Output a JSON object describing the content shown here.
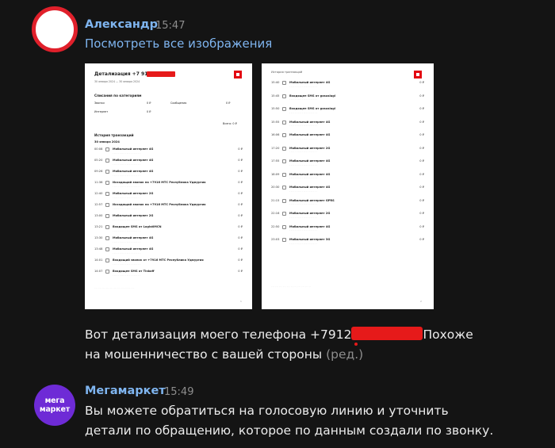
{
  "messages": [
    {
      "author": "Александр",
      "time": "15:47",
      "link_text": "Посмотреть все изображения",
      "text_part1": "Вот детализация моего телефона +7912",
      "text_part2": "Похоже",
      "text_line2": "на мошенничество с вашей стороны",
      "edited_label": "(ред.)"
    },
    {
      "author": "Мегамаркет",
      "time": "15:49",
      "avatar_line1": "мега",
      "avatar_line2": "маркет",
      "text_line1": "Вы можете обратиться на голосовую линию и уточнить",
      "text_line2": "детали по обращению, которое по данным создали по звонку."
    }
  ],
  "doc1": {
    "title": "Детализация +7 912",
    "period": "30 января 2024 — 30 января 2024",
    "section_categories": "Списания по категориям",
    "cat_calls": "Звонки",
    "cat_calls_val": "0 ₽",
    "cat_sms": "Сообщения",
    "cat_sms_val": "0 ₽",
    "cat_internet": "Интернет",
    "cat_internet_val": "0 ₽",
    "total": "Всего: 0 ₽",
    "section_history": "История транзакций",
    "date": "30 января 2024",
    "rows": [
      {
        "time": "00:08",
        "title": "Мобильный интернет 4G",
        "amount": "0 ₽"
      },
      {
        "time": "05:20",
        "title": "Мобильный интернет 4G",
        "amount": "0 ₽"
      },
      {
        "time": "09:26",
        "title": "Мобильный интернет 4G",
        "amount": "0 ₽"
      },
      {
        "time": "11:36",
        "title": "Исходящий звонок на +7916 МТС Республика Удмуртия",
        "amount": "0 ₽"
      },
      {
        "time": "12:40",
        "title": "Мобильный интернет 2G",
        "amount": "0 ₽"
      },
      {
        "time": "12:57",
        "title": "Исходящий звонок на +7916 МТС Республика Удмуртия",
        "amount": "0 ₽"
      },
      {
        "time": "13:00",
        "title": "Мобильный интернет 2G",
        "amount": "0 ₽"
      },
      {
        "time": "13:21",
        "title": "Входящее SMS от LogistiMCN",
        "amount": "0 ₽"
      },
      {
        "time": "13:30",
        "title": "Мобильный интернет 4G",
        "amount": "0 ₽"
      },
      {
        "time": "13:48",
        "title": "Мобильный интернет 4G",
        "amount": "0 ₽"
      },
      {
        "time": "14:01",
        "title": "Входящий звонок от +7916 МТС Республика Удмуртия",
        "amount": "0 ₽"
      },
      {
        "time": "14:07",
        "title": "Входящее SMS от Tinkoff",
        "amount": "0 ₽"
      }
    ]
  },
  "doc2": {
    "header": "История транзакций",
    "rows": [
      {
        "time": "15:40",
        "title": "Мобильный интернет 4G",
        "amount": "0 ₽"
      },
      {
        "time": "15:45",
        "title": "Входящее SMS от gosuslugi",
        "amount": "0 ₽"
      },
      {
        "time": "15:50",
        "title": "Входящее SMS от gosuslugi",
        "amount": "0 ₽"
      },
      {
        "time": "15:55",
        "title": "Мобильный интернет 4G",
        "amount": "0 ₽"
      },
      {
        "time": "16:06",
        "title": "Мобильный интернет 4G",
        "amount": "0 ₽"
      },
      {
        "time": "17:20",
        "title": "Мобильный интернет 2G",
        "amount": "0 ₽"
      },
      {
        "time": "17:55",
        "title": "Мобильный интернет 4G",
        "amount": "0 ₽"
      },
      {
        "time": "18:09",
        "title": "Мобильный интернет 4G",
        "amount": "0 ₽"
      },
      {
        "time": "20:30",
        "title": "Мобильный интернет 4G",
        "amount": "0 ₽"
      },
      {
        "time": "21:15",
        "title": "Мобильный интернет GPRS",
        "amount": "0 ₽"
      },
      {
        "time": "22:16",
        "title": "Мобильный интернет 2G",
        "amount": "0 ₽"
      },
      {
        "time": "22:50",
        "title": "Мобильный интернет 4G",
        "amount": "0 ₽"
      },
      {
        "time": "23:03",
        "title": "Мобильный интернет 3G",
        "amount": "0 ₽"
      }
    ]
  }
}
